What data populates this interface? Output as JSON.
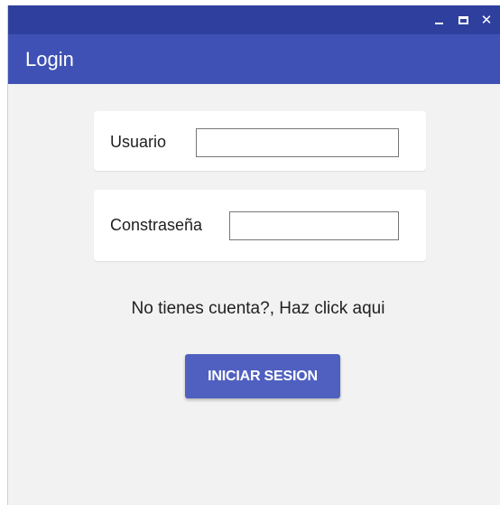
{
  "window": {
    "minimize_icon": "minimize-icon",
    "maximize_icon": "maximize-icon",
    "close_glyph": "✕"
  },
  "appbar": {
    "title": "Login"
  },
  "form": {
    "user_label": "Usuario",
    "user_value": "",
    "password_label": "Constraseña",
    "password_value": ""
  },
  "register_link": "No tienes cuenta?, Haz click aqui",
  "login_button": "INICIAR SESION",
  "colors": {
    "titlebar": "#2f3f9e",
    "appbar": "#3f51b5",
    "button": "#5060c0",
    "background": "#f2f2f2"
  }
}
